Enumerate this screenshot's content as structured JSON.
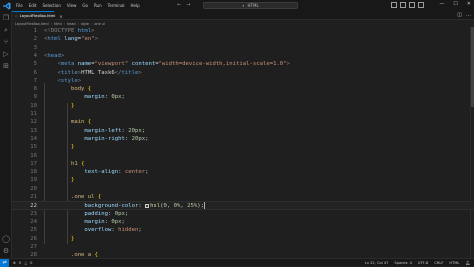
{
  "app": {
    "search_text": "HTML",
    "menu": [
      "File",
      "Edit",
      "Selection",
      "View",
      "Go",
      "Run",
      "Terminal",
      "Help"
    ]
  },
  "tab": {
    "label": "LayoutFlexBox.html"
  },
  "breadcrumb": [
    "LayoutFlexBox.html",
    "html",
    "head",
    "style",
    "one ul"
  ],
  "editor": {
    "current_line": 22,
    "lines": [
      {
        "n": "1",
        "tokens": [
          [
            "t-gray",
            "<!DOCTYPE "
          ],
          [
            "t-tag",
            "html"
          ],
          [
            "t-gray",
            ">"
          ]
        ]
      },
      {
        "n": "2",
        "tokens": [
          [
            "t-gray",
            "<"
          ],
          [
            "t-tag",
            "html "
          ],
          [
            "t-attr",
            "lang"
          ],
          [
            "t-plain",
            "="
          ],
          [
            "t-str",
            "\"en\""
          ],
          [
            "t-gray",
            ">"
          ]
        ]
      },
      {
        "n": "3",
        "tokens": []
      },
      {
        "n": "4",
        "tokens": [
          [
            "t-gray",
            "<"
          ],
          [
            "t-tag",
            "head"
          ],
          [
            "t-gray",
            ">"
          ]
        ]
      },
      {
        "n": "5",
        "tokens": [
          [
            "t-plain",
            "    "
          ],
          [
            "t-gray",
            "<"
          ],
          [
            "t-tag",
            "meta "
          ],
          [
            "t-attr",
            "name"
          ],
          [
            "t-plain",
            "="
          ],
          [
            "t-str",
            "\"viewport\" "
          ],
          [
            "t-attr",
            "content"
          ],
          [
            "t-plain",
            "="
          ],
          [
            "t-str",
            "\"width=device-width,initial-scale=1.0\""
          ],
          [
            "t-gray",
            ">"
          ]
        ]
      },
      {
        "n": "6",
        "tokens": [
          [
            "t-plain",
            "    "
          ],
          [
            "t-gray",
            "<"
          ],
          [
            "t-tag",
            "title"
          ],
          [
            "t-gray",
            ">"
          ],
          [
            "t-plain",
            "HTML Task6"
          ],
          [
            "t-gray",
            "</"
          ],
          [
            "t-tag",
            "title"
          ],
          [
            "t-gray",
            ">"
          ]
        ]
      },
      {
        "n": "7",
        "tokens": [
          [
            "t-plain",
            "    "
          ],
          [
            "t-gray",
            "<"
          ],
          [
            "t-tag",
            "style"
          ],
          [
            "t-gray",
            ">"
          ]
        ]
      },
      {
        "n": "8",
        "tokens": [
          [
            "t-plain",
            "        "
          ],
          [
            "t-sel",
            "body "
          ],
          [
            "t-brace",
            "{"
          ]
        ]
      },
      {
        "n": "9",
        "tokens": [
          [
            "t-plain",
            "            "
          ],
          [
            "t-prop",
            "margin"
          ],
          [
            "t-plain",
            ": "
          ],
          [
            "t-num",
            "0px"
          ],
          [
            "t-plain",
            ";"
          ]
        ]
      },
      {
        "n": "10",
        "tokens": [
          [
            "t-plain",
            "        "
          ],
          [
            "t-brace",
            "}"
          ]
        ]
      },
      {
        "n": "11",
        "tokens": []
      },
      {
        "n": "12",
        "tokens": [
          [
            "t-plain",
            "        "
          ],
          [
            "t-sel",
            "main "
          ],
          [
            "t-brace",
            "{"
          ]
        ]
      },
      {
        "n": "13",
        "tokens": [
          [
            "t-plain",
            "            "
          ],
          [
            "t-prop",
            "margin-left"
          ],
          [
            "t-plain",
            ": "
          ],
          [
            "t-num",
            "20px"
          ],
          [
            "t-plain",
            ";"
          ]
        ]
      },
      {
        "n": "14",
        "tokens": [
          [
            "t-plain",
            "            "
          ],
          [
            "t-prop",
            "margin-right"
          ],
          [
            "t-plain",
            ": "
          ],
          [
            "t-num",
            "20px"
          ],
          [
            "t-plain",
            ";"
          ]
        ]
      },
      {
        "n": "15",
        "tokens": [
          [
            "t-plain",
            "        "
          ],
          [
            "t-brace",
            "}"
          ]
        ]
      },
      {
        "n": "16",
        "tokens": []
      },
      {
        "n": "17",
        "tokens": [
          [
            "t-plain",
            "        "
          ],
          [
            "t-sel",
            "h1 "
          ],
          [
            "t-brace",
            "{"
          ]
        ]
      },
      {
        "n": "18",
        "tokens": [
          [
            "t-plain",
            "            "
          ],
          [
            "t-prop",
            "text-align"
          ],
          [
            "t-plain",
            ": "
          ],
          [
            "t-val",
            "center"
          ],
          [
            "t-plain",
            ";"
          ]
        ]
      },
      {
        "n": "19",
        "tokens": [
          [
            "t-plain",
            "        "
          ],
          [
            "t-brace",
            "}"
          ]
        ]
      },
      {
        "n": "20",
        "tokens": []
      },
      {
        "n": "21",
        "tokens": [
          [
            "t-plain",
            "        "
          ],
          [
            "t-sel",
            ".one ul "
          ],
          [
            "t-brace",
            "{"
          ]
        ]
      },
      {
        "n": "22",
        "tokens": [
          [
            "t-plain",
            "            "
          ],
          [
            "t-prop",
            "background-color"
          ],
          [
            "t-plain",
            ": "
          ],
          [
            "swatch",
            ""
          ],
          [
            "t-kw",
            "hsl"
          ],
          [
            "t-plain",
            "("
          ],
          [
            "t-num",
            "0"
          ],
          [
            "t-plain",
            ", "
          ],
          [
            "t-num",
            "0%"
          ],
          [
            "t-plain",
            ", "
          ],
          [
            "t-num",
            "25%"
          ],
          [
            "t-plain",
            ");"
          ],
          [
            "cursor",
            ""
          ]
        ]
      },
      {
        "n": "23",
        "tokens": [
          [
            "t-plain",
            "            "
          ],
          [
            "t-prop",
            "padding"
          ],
          [
            "t-plain",
            ": "
          ],
          [
            "t-num",
            "0px"
          ],
          [
            "t-plain",
            ";"
          ]
        ]
      },
      {
        "n": "24",
        "tokens": [
          [
            "t-plain",
            "            "
          ],
          [
            "t-prop",
            "margin"
          ],
          [
            "t-plain",
            ": "
          ],
          [
            "t-num",
            "0px"
          ],
          [
            "t-plain",
            ";"
          ]
        ]
      },
      {
        "n": "25",
        "tokens": [
          [
            "t-plain",
            "            "
          ],
          [
            "t-prop",
            "overflow"
          ],
          [
            "t-plain",
            ": "
          ],
          [
            "t-val",
            "hidden"
          ],
          [
            "t-plain",
            ";"
          ]
        ]
      },
      {
        "n": "26",
        "tokens": [
          [
            "t-plain",
            "        "
          ],
          [
            "t-brace",
            "}"
          ]
        ]
      },
      {
        "n": "27",
        "tokens": []
      },
      {
        "n": "28",
        "tokens": [
          [
            "t-plain",
            "        "
          ],
          [
            "t-sel",
            ".one a "
          ],
          [
            "t-brace",
            "{"
          ]
        ]
      }
    ]
  },
  "status": {
    "errors": "0",
    "warnings": "0",
    "position": "Ln 22, Col 47",
    "spaces": "Spaces: 4",
    "encoding": "UTF-8",
    "eol": "CRLF",
    "language": "HTML"
  }
}
